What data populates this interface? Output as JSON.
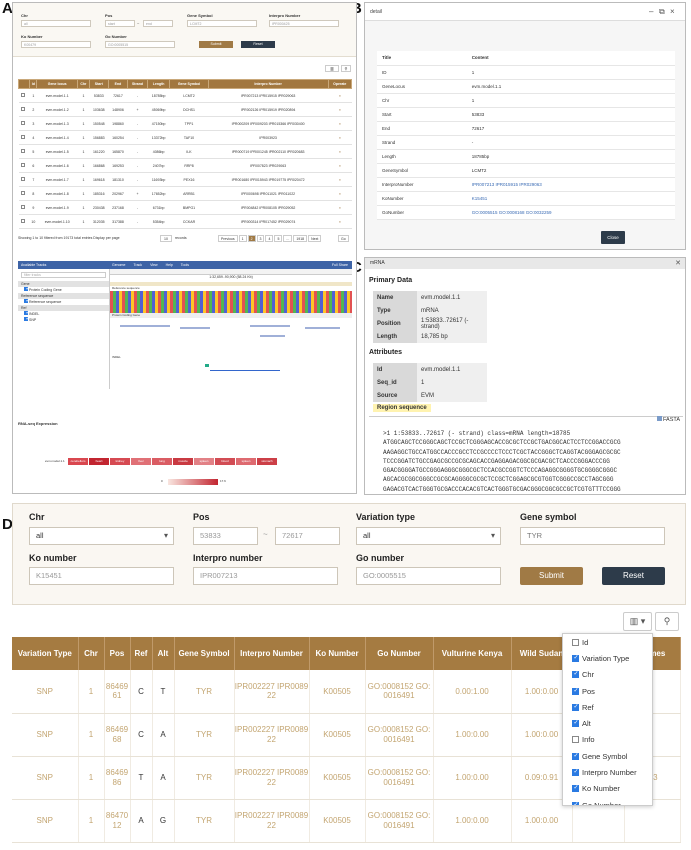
{
  "labels": {
    "a": "A",
    "b": "B",
    "c": "C",
    "d": "D"
  },
  "panelA": {
    "form": {
      "chr": "Chr",
      "chr_val": "all",
      "pos": "Pos",
      "pos_start": "start",
      "pos_sep": "~",
      "pos_end": "end",
      "gene": "Gene Symbol",
      "gene_val": "LCMT2",
      "interpro": "Interpro Number",
      "interpro_val": "IPR000425",
      "ko": "Ko Number",
      "ko_val": "K00479",
      "go": "Go Number",
      "go_val": "GO:0005515",
      "submit": "Submit",
      "reset": "Reset"
    },
    "table": {
      "headers": [
        "",
        "Id",
        "Gene locus",
        "Chr",
        "Start",
        "End",
        "Strand",
        "Length",
        "Gene Symbol",
        "Interpro Number",
        "Operate"
      ],
      "rows": [
        [
          "1",
          "evm.model.1.1",
          "1",
          "53833",
          "72617",
          "-",
          "18785bp",
          "LCMT2",
          "IPR007213 IPR015915 IPR029063"
        ],
        [
          "2",
          "evm.model.1.2",
          "1",
          "103638",
          "148906",
          "+",
          "45069bp",
          "DCHS1",
          "IPR002126 IPR015919 IPR020894"
        ],
        [
          "3",
          "evm.model.1.3",
          "1",
          "150548",
          "198860",
          "-",
          "47150bp",
          "TPP1",
          "IPR000209 IPR009203 IPR015366 IPR030400"
        ],
        [
          "4",
          "evm.model.1.4",
          "1",
          "156883",
          "160254",
          "-",
          "13372bp",
          "TAF10",
          "IPR003923"
        ],
        [
          "5",
          "evm.model.1.5",
          "1",
          "161220",
          "165870",
          "-",
          "4086bp",
          "ILK",
          "IPR000719 IPR001245 IPR002110 IPR020683"
        ],
        [
          "6",
          "evm.model.1.6",
          "1",
          "166868",
          "169253",
          "-",
          "2407bp",
          "RRP8",
          "IPR007823 IPR029063"
        ],
        [
          "7",
          "evm.model.1.7",
          "1",
          "169618",
          "181310",
          "-",
          "11693bp",
          "PEX16",
          "IPR001680 IPR015943 IPR019775 IPR020472"
        ],
        [
          "8",
          "evm.model.1.8",
          "1",
          "185316",
          "202967",
          "+",
          "17652bp",
          "ARRB1",
          "IPR000698 IPR011021 IPR011022"
        ],
        [
          "9",
          "evm.model.1.9",
          "1",
          "230438",
          "237168",
          "-",
          "6731bp",
          "BMPG1",
          "IPR004842 IPR008105 IPR029052"
        ],
        [
          "10",
          "evm.model.1.10",
          "1",
          "312035",
          "317388",
          "-",
          "5354bp",
          "CCKAR",
          "IPR000314 IPR017452 IPR029074"
        ]
      ],
      "op_icon": "≡"
    },
    "pager": {
      "info": "Showing 1 to 10 filtered from 19173 total entries  Display per page",
      "per_page": "10",
      "records": "records",
      "pages": [
        "Previous",
        "1",
        "2",
        "3",
        "4",
        "5",
        "...",
        "1918",
        "Next"
      ],
      "go": "Go"
    },
    "jbrowse": {
      "menu": [
        "Genome",
        "Track",
        "View",
        "Help",
        "Tools"
      ],
      "right": "Full Share",
      "available": "Available Tracks",
      "filter": "filter tracks",
      "groups": [
        "Gene",
        "Reference sequence",
        "Ref"
      ],
      "items": [
        "Protein Coding Gene",
        "Reference sequence",
        "INDEL",
        "SNP"
      ],
      "track1": "Reference sequence",
      "track2": "Protein Coding Gene",
      "track3": "INDEL",
      "locus": "1:32,659..90,900 (58.24 Kb)"
    },
    "rna": {
      "title": "RNA-seq Expression",
      "gene": "evm.model.1.1",
      "tissues": [
        "cerebellum",
        "heart",
        "kidney",
        "liver",
        "lung",
        "muscle",
        "spleen",
        "blood",
        "spleen",
        "stomach"
      ],
      "scale_min": "0",
      "scale_max": "17.6"
    }
  },
  "panelB": {
    "title": "detail",
    "headers": [
      "Title",
      "Content"
    ],
    "rows": [
      [
        "ID",
        "1"
      ],
      [
        "GeneLocus",
        "evm.model.1.1"
      ],
      [
        "Chr",
        "1"
      ],
      [
        "Start",
        "53833"
      ],
      [
        "End",
        "72617"
      ],
      [
        "Strand",
        "-"
      ],
      [
        "Length",
        "18785bp"
      ],
      [
        "GeneSymbol",
        "LCMT2"
      ],
      [
        "InterproNumber",
        "IPR007213 IPR015915 IPR029063"
      ],
      [
        "KoNumber",
        "K15451"
      ],
      [
        "GoNumber",
        "GO:0005515 GO:0008168 GO:0032259"
      ]
    ],
    "close": "Close"
  },
  "panelC": {
    "title": "mRNA",
    "primary": "Primary Data",
    "primary_rows": [
      [
        "Name",
        "evm.model.1.1"
      ],
      [
        "Type",
        "mRNA"
      ],
      [
        "Position",
        "1:53833..72617 (- strand)"
      ],
      [
        "Length",
        "18,785 bp"
      ]
    ],
    "attributes": "Attributes",
    "attr_rows": [
      [
        "Id",
        "evm.model.1.1"
      ],
      [
        "Seq_id",
        "1"
      ],
      [
        "Source",
        "EVM"
      ]
    ],
    "region": "Region sequence",
    "fasta": "FASTA",
    "seq": ">1 1:53833..72617 (- strand) class=mRNA length=18785\nATGGCAGCTCCGGGCAGCTCCGCTCGGGAGCACCGCGCTCCGCTGACGGCACTCCTCCGGACCGCG\nAAGAGGCTGCCATGGCCACCCGCCTCCGCCCCTCCCTCGCTACCGGGCTCAGGTACGGGAGCGCGC\nTCCCGGATCTGCCGAGCGCCGCGCAGCACCGAGGAGACGGCGCGACGCTCACCCGGGACCCGG\nGGACGGGGATGCCGGGAGGGCGGGCGCTCCACGCCGGTCTCCCAGAGGCGGGGTGCGGGGCGGGC\nAGCACGCGGCGGGCCGCGCAGGGGCGCGCTCCGCTCGGAGCGCGTGGTCGGGCCGCCTAGCGGG\nGAGACGTCACTGGGTGCGACCCACACGTCACTGGGTGCGACGGGCGGCGCCGCTCGTGTTTCCGGG"
  },
  "panelD": {
    "form": {
      "chr": "Chr",
      "chr_val": "all",
      "pos": "Pos",
      "pos_start": "53833",
      "pos_sep": "~",
      "pos_end": "72617",
      "var": "Variation type",
      "var_val": "all",
      "gene": "Gene symbol",
      "gene_val": "TYR",
      "ko": "Ko number",
      "ko_val": "K15451",
      "interpro": "Interpro number",
      "interpro_val": "IPR007213",
      "go": "Go number",
      "go_val": "GO:0005515",
      "submit": "Submit",
      "reset": "Reset"
    },
    "tools": {
      "columns_icon": "▥ ▾",
      "search_icon": "⚲"
    },
    "headers": [
      "Variation Type",
      "Chr",
      "Pos",
      "Ref",
      "Alt",
      "Gene Symbol",
      "Interpro Number",
      "Ko Number",
      "Go Number",
      "Vulturine Kenya",
      "Wild Sudan",
      "Wild",
      "Domes"
    ],
    "rows": [
      [
        "SNP",
        "1",
        "8646961",
        "C",
        "T",
        "TYR",
        "IPR002227 IPR008922",
        "K00505",
        "GO:0008152 GO:0016491",
        "0.00:1.00",
        "1.00:0.00",
        "",
        ""
      ],
      [
        "SNP",
        "1",
        "8646968",
        "C",
        "A",
        "TYR",
        "IPR002227 IPR008922",
        "K00505",
        "GO:0008152 GO:0016491",
        "1.00:0.00",
        "1.00:0.00",
        "",
        ""
      ],
      [
        "SNP",
        "1",
        "8646986",
        "T",
        "A",
        "TYR",
        "IPR002227 IPR008922",
        "K00505",
        "GO:0008152 GO:0016491",
        "1.00:0.00",
        "0.09:0.91",
        "",
        "0.3"
      ],
      [
        "SNP",
        "1",
        "8647012",
        "A",
        "G",
        "TYR",
        "IPR002227 IPR008922",
        "K00505",
        "GO:0008152 GO:0016491",
        "1.00:0.00",
        "1.00:0.00",
        "",
        ""
      ]
    ],
    "columns": [
      {
        "label": "Id",
        "checked": false
      },
      {
        "label": "Variation Type",
        "checked": true
      },
      {
        "label": "Chr",
        "checked": true
      },
      {
        "label": "Pos",
        "checked": true
      },
      {
        "label": "Ref",
        "checked": true
      },
      {
        "label": "Alt",
        "checked": true
      },
      {
        "label": "Info",
        "checked": false
      },
      {
        "label": "Gene Symbol",
        "checked": true
      },
      {
        "label": "Interpro Number",
        "checked": true
      },
      {
        "label": "Ko Number",
        "checked": true
      },
      {
        "label": "Go Number",
        "checked": true
      }
    ]
  },
  "colors": {
    "brown": "#a57b41",
    "navy": "#2d3b4a",
    "submit": "#a07a45",
    "link": "#3a6bb4"
  }
}
